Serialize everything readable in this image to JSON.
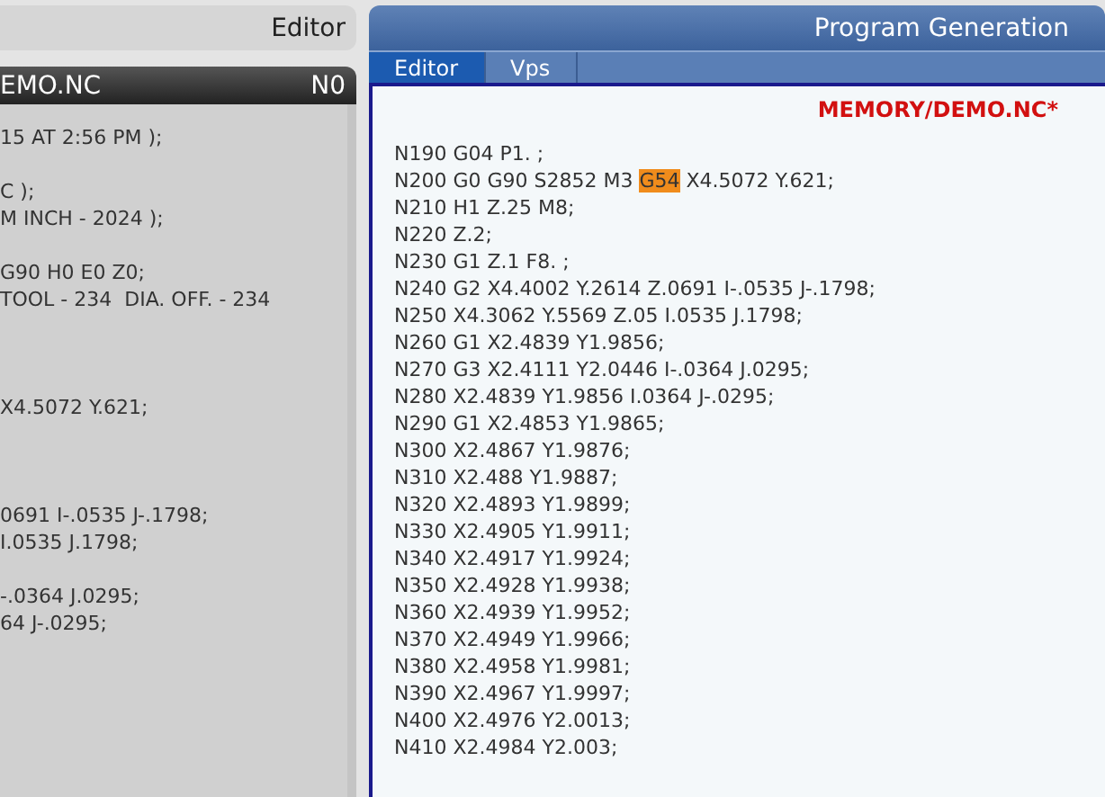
{
  "left_panel": {
    "header": "Editor",
    "title_bar": {
      "file": "EMO.NC",
      "line": "N0"
    },
    "line_groups": [
      [
        "15 AT 2:56 PM );"
      ],
      [
        "C );",
        "M INCH - 2024 );"
      ],
      [
        "G90 H0 E0 Z0;",
        "TOOL - 234  DIA. OFF. - 234"
      ],
      [
        "X4.5072 Y.621;"
      ],
      [
        "0691 I-.0535 J-.1798;",
        "I.0535 J.1798;"
      ],
      [
        "-.0364 J.0295;",
        "64 J-.0295;"
      ]
    ]
  },
  "right_panel": {
    "title": "Program Generation",
    "tabs": [
      {
        "label": "Editor",
        "selected": true
      },
      {
        "label": "Vps",
        "selected": false
      }
    ],
    "file_path": "MEMORY/DEMO.NC*",
    "lines": [
      {
        "segments": [
          {
            "text": "N190 G04 P1. ;",
            "highlighted": false
          }
        ]
      },
      {
        "segments": [
          {
            "text": "N200 G0 G90 S2852 M3 ",
            "highlighted": false
          },
          {
            "text": "G54",
            "highlighted": true
          },
          {
            "text": " X4.5072 Y.621;",
            "highlighted": false
          }
        ]
      },
      {
        "segments": [
          {
            "text": "N210 H1 Z.25 M8;",
            "highlighted": false
          }
        ]
      },
      {
        "segments": [
          {
            "text": "N220 Z.2;",
            "highlighted": false
          }
        ]
      },
      {
        "segments": [
          {
            "text": "N230 G1 Z.1 F8. ;",
            "highlighted": false
          }
        ]
      },
      {
        "segments": [
          {
            "text": "N240 G2 X4.4002 Y.2614 Z.0691 I-.0535 J-.1798;",
            "highlighted": false
          }
        ]
      },
      {
        "segments": [
          {
            "text": "N250 X4.3062 Y.5569 Z.05 I.0535 J.1798;",
            "highlighted": false
          }
        ]
      },
      {
        "segments": [
          {
            "text": "N260 G1 X2.4839 Y1.9856;",
            "highlighted": false
          }
        ]
      },
      {
        "segments": [
          {
            "text": "N270 G3 X2.4111 Y2.0446 I-.0364 J.0295;",
            "highlighted": false
          }
        ]
      },
      {
        "segments": [
          {
            "text": "N280 X2.4839 Y1.9856 I.0364 J-.0295;",
            "highlighted": false
          }
        ]
      },
      {
        "segments": [
          {
            "text": "N290 G1 X2.4853 Y1.9865;",
            "highlighted": false
          }
        ]
      },
      {
        "segments": [
          {
            "text": "N300 X2.4867 Y1.9876;",
            "highlighted": false
          }
        ]
      },
      {
        "segments": [
          {
            "text": "N310 X2.488 Y1.9887;",
            "highlighted": false
          }
        ]
      },
      {
        "segments": [
          {
            "text": "N320 X2.4893 Y1.9899;",
            "highlighted": false
          }
        ]
      },
      {
        "segments": [
          {
            "text": "N330 X2.4905 Y1.9911;",
            "highlighted": false
          }
        ]
      },
      {
        "segments": [
          {
            "text": "N340 X2.4917 Y1.9924;",
            "highlighted": false
          }
        ]
      },
      {
        "segments": [
          {
            "text": "N350 X2.4928 Y1.9938;",
            "highlighted": false
          }
        ]
      },
      {
        "segments": [
          {
            "text": "N360 X2.4939 Y1.9952;",
            "highlighted": false
          }
        ]
      },
      {
        "segments": [
          {
            "text": "N370 X2.4949 Y1.9966;",
            "highlighted": false
          }
        ]
      },
      {
        "segments": [
          {
            "text": "N380 X2.4958 Y1.9981;",
            "highlighted": false
          }
        ]
      },
      {
        "segments": [
          {
            "text": "N390 X2.4967 Y1.9997;",
            "highlighted": false
          }
        ]
      },
      {
        "segments": [
          {
            "text": "N400 X2.4976 Y2.0013;",
            "highlighted": false
          }
        ]
      },
      {
        "segments": [
          {
            "text": "N410 X2.4984 Y2.003;",
            "highlighted": false
          }
        ]
      }
    ]
  }
}
